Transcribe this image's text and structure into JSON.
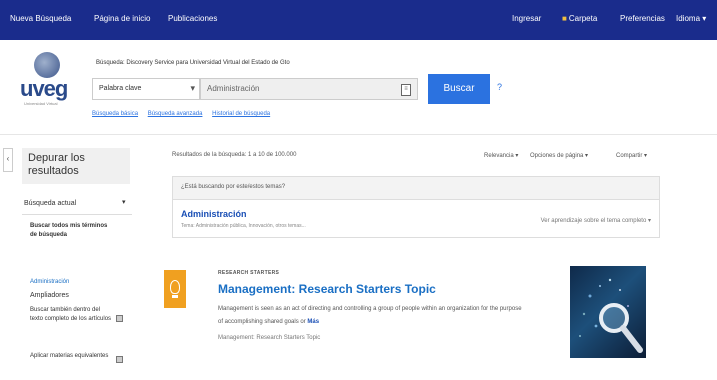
{
  "topbar": {
    "left": [
      "Nueva Búsqueda",
      "Página de inicio",
      "Publicaciones"
    ],
    "right": [
      "Ingresar",
      "Carpeta",
      "Preferencias",
      "Idioma"
    ]
  },
  "logo": {
    "text": "uveg",
    "subtitle": "Universidad Virtual"
  },
  "search": {
    "description": "Búsqueda: Discovery Service para Universidad Virtual del Estado de Gto",
    "field": "Palabra clave",
    "query": "Administración",
    "button": "Buscar",
    "help": "?",
    "links": [
      "Búsqueda básica",
      "Búsqueda avanzada",
      "Historial de búsqueda"
    ]
  },
  "sidebar": {
    "refine_title": "Depurar los resultados",
    "current_search": "Búsqueda actual",
    "search_all_terms": "Buscar todos mis términos de búsqueda",
    "term": "Administración",
    "expanders_heading": "Ampliadores",
    "expander_1": "Buscar también dentro del texto completo de los artículos",
    "expander_2": "Aplicar materias equivalentes"
  },
  "results": {
    "count": "Resultados de la búsqueda: 1 a 10 de 100.000",
    "options": [
      "Relevancia",
      "Opciones de página",
      "Compartir"
    ]
  },
  "suggestion": {
    "header": "¿Está buscando por este/estos temas?",
    "title": "Administración",
    "subtitle": "Tema: Administración pública, Innovación, otros temas...",
    "right": "Ver aprendizaje sobre el tema completo"
  },
  "result_card": {
    "type_label": "RESEARCH STARTERS",
    "title": "Management: Research Starters Topic",
    "snippet": "Management is seen as an act of directing and controlling a group of people within an organization for the purpose of accomplishing shared goals or",
    "more_label": "Más",
    "meta": "Management: Research Starters Topic"
  },
  "colors": {
    "topbar": "#1a2c8c",
    "button": "#2b72e0",
    "link": "#1a6fc4",
    "research_icon": "#f0a020"
  }
}
